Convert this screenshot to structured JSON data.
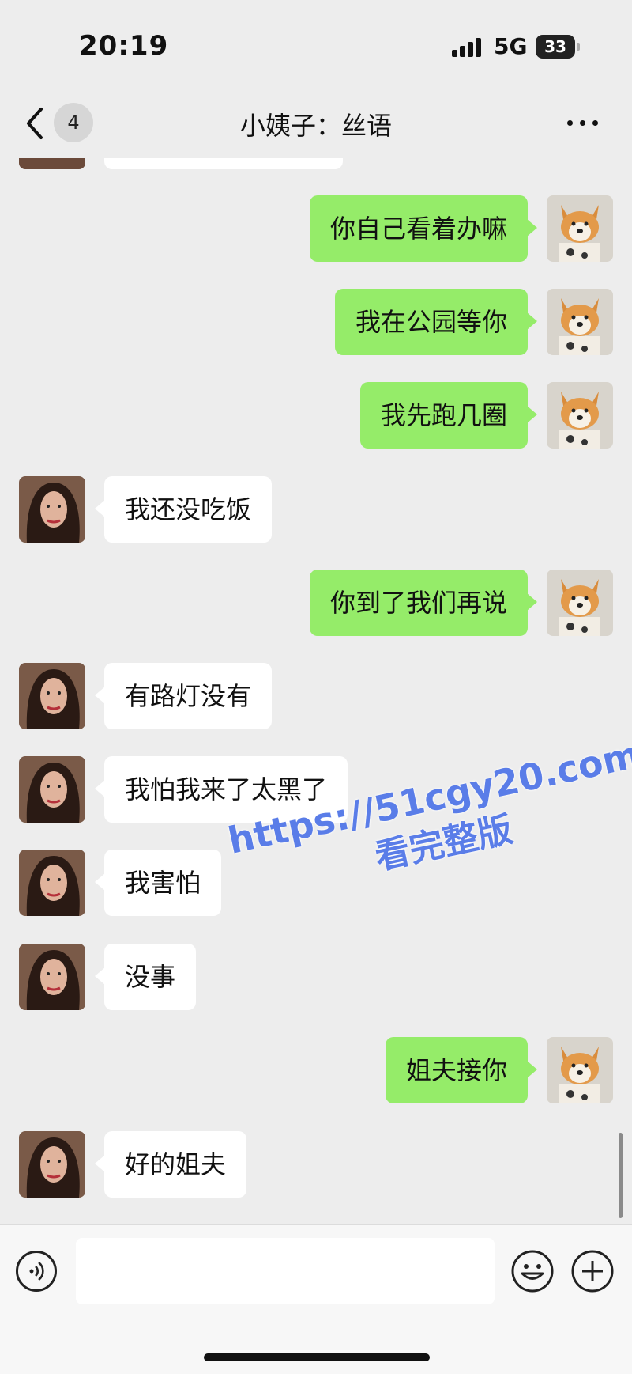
{
  "status_bar": {
    "time": "20:19",
    "network": "5G",
    "battery": "33"
  },
  "header": {
    "back_icon": "chevron-left-icon",
    "unread_count": "4",
    "title": "小姨子：丝语",
    "more_icon": "more-dots-icon"
  },
  "messages": [
    {
      "side": "left",
      "text": ""
    },
    {
      "side": "right",
      "text": "你自己看着办嘛"
    },
    {
      "side": "right",
      "text": "我在公园等你"
    },
    {
      "side": "right",
      "text": "我先跑几圈"
    },
    {
      "side": "left",
      "text": "我还没吃饭"
    },
    {
      "side": "right",
      "text": "你到了我们再说"
    },
    {
      "side": "left",
      "text": "有路灯没有"
    },
    {
      "side": "left",
      "text": "我怕我来了太黑了"
    },
    {
      "side": "left",
      "text": "我害怕"
    },
    {
      "side": "left",
      "text": "没事"
    },
    {
      "side": "right",
      "text": "姐夫接你"
    },
    {
      "side": "left",
      "text": "好的姐夫"
    }
  ],
  "watermark": {
    "url": "https://51cgy20.com",
    "text": "看完整版"
  },
  "input_bar": {
    "voice_icon": "voice-icon",
    "input_value": "",
    "emoji_icon": "emoji-icon",
    "plus_icon": "plus-icon"
  },
  "colors": {
    "background": "#ededed",
    "sent_bubble": "#95ec69",
    "received_bubble": "#ffffff",
    "watermark": "#5a7de8"
  }
}
